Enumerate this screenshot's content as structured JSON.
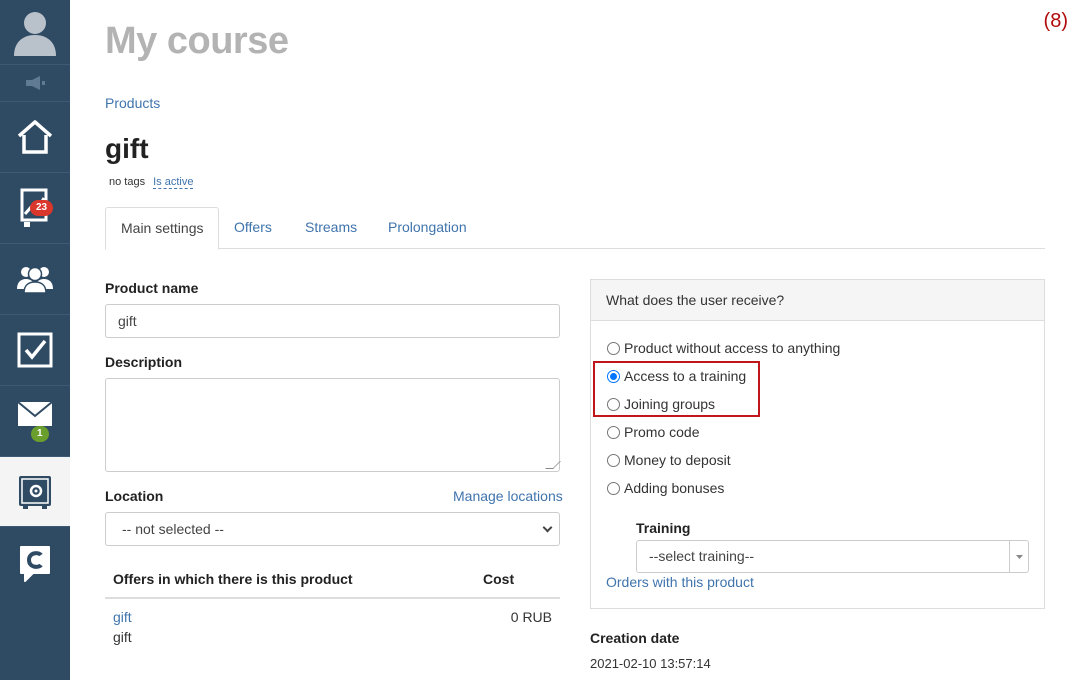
{
  "page": {
    "title": "My course",
    "counter": "(8)",
    "breadcrumb": "Products"
  },
  "sidebar": {
    "items": [
      {
        "icon": "user-avatar-icon"
      },
      {
        "icon": "megaphone-icon"
      },
      {
        "icon": "home-icon"
      },
      {
        "icon": "stats-icon",
        "badge": "23"
      },
      {
        "icon": "users-icon"
      },
      {
        "icon": "tasks-checkbox-icon"
      },
      {
        "icon": "mail-icon",
        "badge": "1"
      },
      {
        "icon": "safe-settings-icon",
        "active": true
      },
      {
        "icon": "chat-logo-icon"
      }
    ]
  },
  "product": {
    "title": "gift",
    "tags": "no tags",
    "status": "Is active"
  },
  "tabs": [
    {
      "label": "Main settings",
      "active": true
    },
    {
      "label": "Offers"
    },
    {
      "label": "Streams"
    },
    {
      "label": "Prolongation"
    }
  ],
  "form": {
    "product_name_label": "Product name",
    "product_name_value": "gift",
    "description_label": "Description",
    "description_value": "",
    "location_label": "Location",
    "manage_locations": "Manage locations",
    "location_value": "-- not selected --"
  },
  "offers_table": {
    "headers": [
      "Offers in which there is this product",
      "Cost"
    ],
    "rows": [
      {
        "name": "gift",
        "sub": "gift",
        "cost": "0 RUB"
      }
    ]
  },
  "receive_panel": {
    "title": "What does the user receive?",
    "options": [
      {
        "label": "Product without access to anything",
        "checked": false
      },
      {
        "label": "Access to a training",
        "checked": true
      },
      {
        "label": "Joining groups",
        "checked": false
      },
      {
        "label": "Promo code",
        "checked": false
      },
      {
        "label": "Money to deposit",
        "checked": false
      },
      {
        "label": "Adding bonuses",
        "checked": false
      }
    ],
    "training_label": "Training",
    "training_placeholder": "--select training--",
    "orders_link": "Orders with this product"
  },
  "creation": {
    "label": "Creation date",
    "value": "2021-02-10 13:57:14"
  },
  "colors": {
    "sidebar": "#2f4a63",
    "link": "#3f74ad",
    "highlight": "#c0161b",
    "badge_red": "#d9372c",
    "badge_green": "#6a9e2d"
  }
}
